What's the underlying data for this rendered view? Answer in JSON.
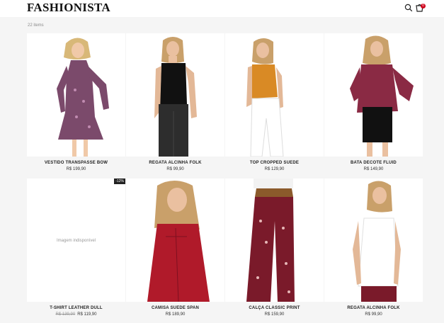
{
  "header": {
    "logo": "FASHIONISTA",
    "cart_count": "0"
  },
  "listing": {
    "count_label": "22 items"
  },
  "products": [
    {
      "name": "VESTIDO TRANSPASSE BOW",
      "price": "R$ 199,90"
    },
    {
      "name": "REGATA ALCINHA FOLK",
      "price": "R$ 99,90"
    },
    {
      "name": "TOP CROPPED SUEDE",
      "price": "R$ 129,90"
    },
    {
      "name": "BATA DECOTE FLUID",
      "price": "R$ 149,90"
    },
    {
      "name": "T-SHIRT LEATHER DULL",
      "old_price": "R$ 139,90",
      "price": "R$ 119,90",
      "discount": "-12%",
      "image_text": "Imagem indisponível"
    },
    {
      "name": "CAMISA SUEDE SPAN",
      "price": "R$ 189,90"
    },
    {
      "name": "CALÇA CLASSIC PRINT",
      "price": "R$ 159,90"
    },
    {
      "name": "REGATA ALCINHA FOLK",
      "price": "R$ 99,90"
    }
  ],
  "colors": {
    "brand_dark": "#111111",
    "accent_red": "#d0021b",
    "background": "#f5f5f5"
  }
}
